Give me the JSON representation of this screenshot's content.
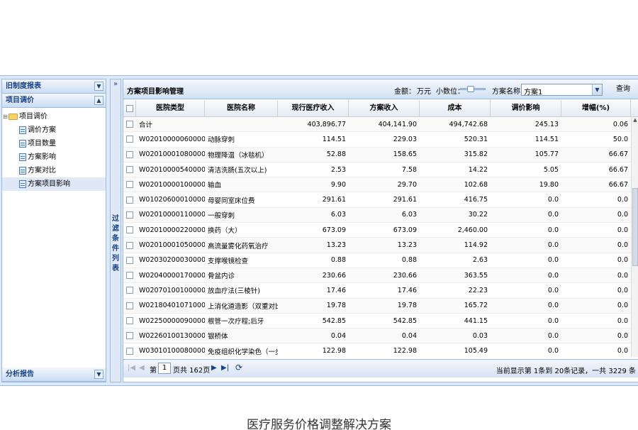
{
  "sidebar": {
    "sections": [
      {
        "title": "旧制度报表"
      },
      {
        "title": "项目调价"
      },
      {
        "title": "分析报告"
      }
    ],
    "tree_root": "项目调价",
    "tree_items": [
      "调价方案",
      "项目数量",
      "方案影响",
      "方案对比",
      "方案项目影响"
    ]
  },
  "filter": {
    "title": "过滤条件列表",
    "expand_glyph": "»"
  },
  "main": {
    "title": "方案项目影响管理",
    "amount_label": "金额：",
    "amount_unit": "万元",
    "decimal_label": "小数位：",
    "scheme_label": "方案名称：",
    "scheme_value": "方案1",
    "query_label": "查询"
  },
  "grid": {
    "headers": [
      "医院类型",
      "医院名称",
      "现行医疗收入",
      "方案收入",
      "成本",
      "调价影响",
      "增幅(%)"
    ],
    "rows": [
      [
        "合计",
        "",
        "403,896.77",
        "404,141.90",
        "494,742.68",
        "245.13",
        "0.06"
      ],
      [
        "W020100000600000",
        "动脉穿刺",
        "114.51",
        "229.03",
        "520.31",
        "114.51",
        "50.0"
      ],
      [
        "W020100010800000",
        "物理降温（冰毯机）",
        "52.88",
        "158.65",
        "315.82",
        "105.77",
        "66.67"
      ],
      [
        "W020100005400000",
        "清洁洗肠(五次以上)",
        "2.53",
        "7.58",
        "14.22",
        "5.05",
        "66.67"
      ],
      [
        "W020100001000000",
        "输血",
        "9.90",
        "29.70",
        "102.68",
        "19.80",
        "66.67"
      ],
      [
        "W010206000100000",
        "母婴同室床位费",
        "291.61",
        "291.61",
        "416.75",
        "0.0",
        "0.0"
      ],
      [
        "W020100001100000",
        "一般穿刺",
        "6.03",
        "6.03",
        "30.22",
        "0.0",
        "0.0"
      ],
      [
        "W020100002200000",
        "换药（大）",
        "673.09",
        "673.09",
        "2,460.00",
        "0.0",
        "0.0"
      ],
      [
        "W020100010500000",
        "高流量雾化药氧治疗",
        "13.23",
        "13.23",
        "114.92",
        "0.0",
        "0.0"
      ],
      [
        "W020302000300000",
        "支撑喉镜检查",
        "0.88",
        "0.88",
        "2.63",
        "0.0",
        "0.0"
      ],
      [
        "W020400001700000",
        "骨盆内诊",
        "230.66",
        "230.66",
        "363.55",
        "0.0",
        "0.0"
      ],
      [
        "W020701001000000",
        "放血疗法(三棱针)",
        "17.46",
        "17.46",
        "22.23",
        "0.0",
        "0.0"
      ],
      [
        "W021804010710000",
        "上消化道造影（双重对比...",
        "19.78",
        "19.78",
        "165.72",
        "0.0",
        "0.0"
      ],
      [
        "W022500000900000",
        "根管一次疗程;后牙",
        "542.85",
        "542.85",
        "441.15",
        "0.0",
        "0.0"
      ],
      [
        "W022601001300000",
        "银桥体",
        "0.04",
        "0.04",
        "0.03",
        "0.0",
        "0.0"
      ],
      [
        "W030101000800000",
        "免疫组织化学染色（一步...",
        "122.98",
        "122.98",
        "105.49",
        "0.0",
        "0.0"
      ]
    ]
  },
  "pager": {
    "page_prefix": "第",
    "page_value": "1",
    "page_suffix": "页共 162页",
    "info": "当前显示第 1条到 20条记录，一共 3229 条"
  },
  "caption": "医疗服务价格调整解决方案"
}
